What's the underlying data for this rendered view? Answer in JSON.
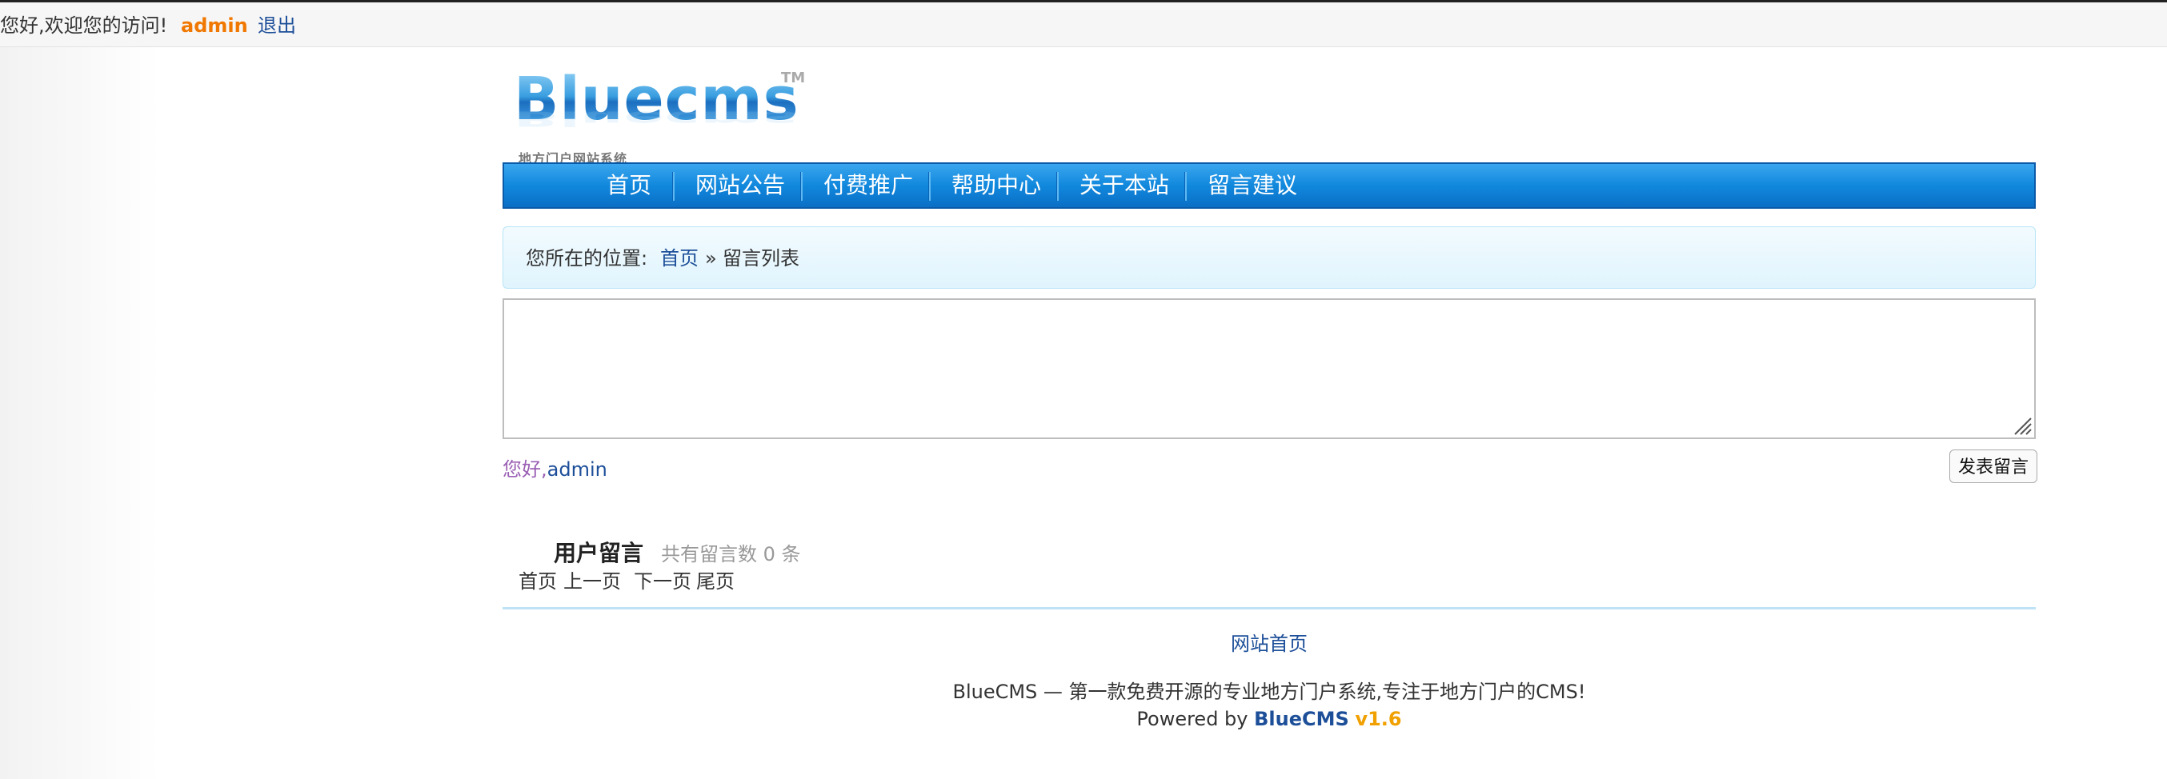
{
  "topbar": {
    "greeting": "您好,欢迎您的访问!",
    "username": "admin",
    "logout": "退出"
  },
  "logo": {
    "text": "Bluecms",
    "tm": "TM",
    "tagline": "地方门户网站系统"
  },
  "nav": {
    "items": [
      {
        "label": "首页"
      },
      {
        "label": "网站公告"
      },
      {
        "label": "付费推广"
      },
      {
        "label": "帮助中心"
      },
      {
        "label": "关于本站"
      },
      {
        "label": "留言建议"
      }
    ]
  },
  "breadcrumb": {
    "prefix": "您所在的位置:",
    "home": "首页",
    "separator": "»",
    "current": "留言列表"
  },
  "message_form": {
    "textarea_value": "",
    "hello_prefix": "您好,",
    "hello_user": "admin",
    "submit_label": "发表留言"
  },
  "comments": {
    "title": "用户留言",
    "count_text": "共有留言数 0 条",
    "pager": {
      "first": "首页",
      "prev": "上一页",
      "next": "下一页",
      "last": "尾页"
    }
  },
  "footer": {
    "home_link": "网站首页",
    "description": "BlueCMS — 第一款免费开源的专业地方门户系统,专注于地方门户的CMS!",
    "powered_prefix": "Powered by ",
    "brand": "BlueCMS",
    "version": "v1.6"
  },
  "colors": {
    "nav_blue": "#1188dd",
    "link_blue": "#1d4f99",
    "username_orange": "#f07800",
    "version_orange": "#f0a000"
  }
}
